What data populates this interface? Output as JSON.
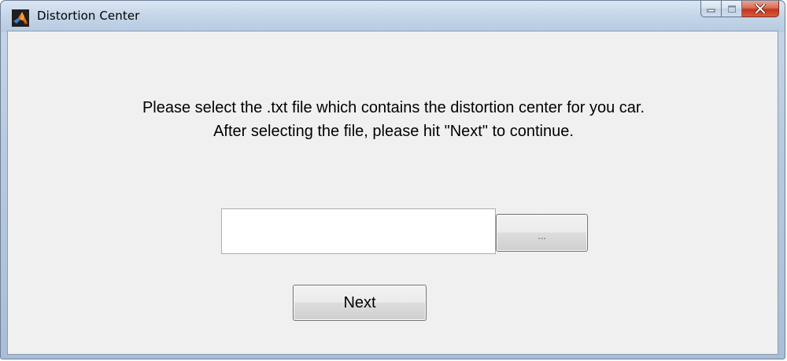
{
  "window": {
    "title": "Distortion Center",
    "title_icon": "matlab-logo-icon",
    "caption_buttons": {
      "minimize": "minimize-icon",
      "maximize": "maximize-icon",
      "close": "close-icon"
    }
  },
  "dialog": {
    "instruction_line_1": "Please select the .txt file which contains the distortion center for you car.",
    "instruction_line_2": "After selecting the file, please hit \"Next\" to continue.",
    "file_path_value": "",
    "browse_label": "...",
    "next_label": "Next"
  },
  "colors": {
    "dialog_background": "#f0f0f0",
    "close_button": "#c2351d",
    "titlebar": "#c4d5e8"
  }
}
